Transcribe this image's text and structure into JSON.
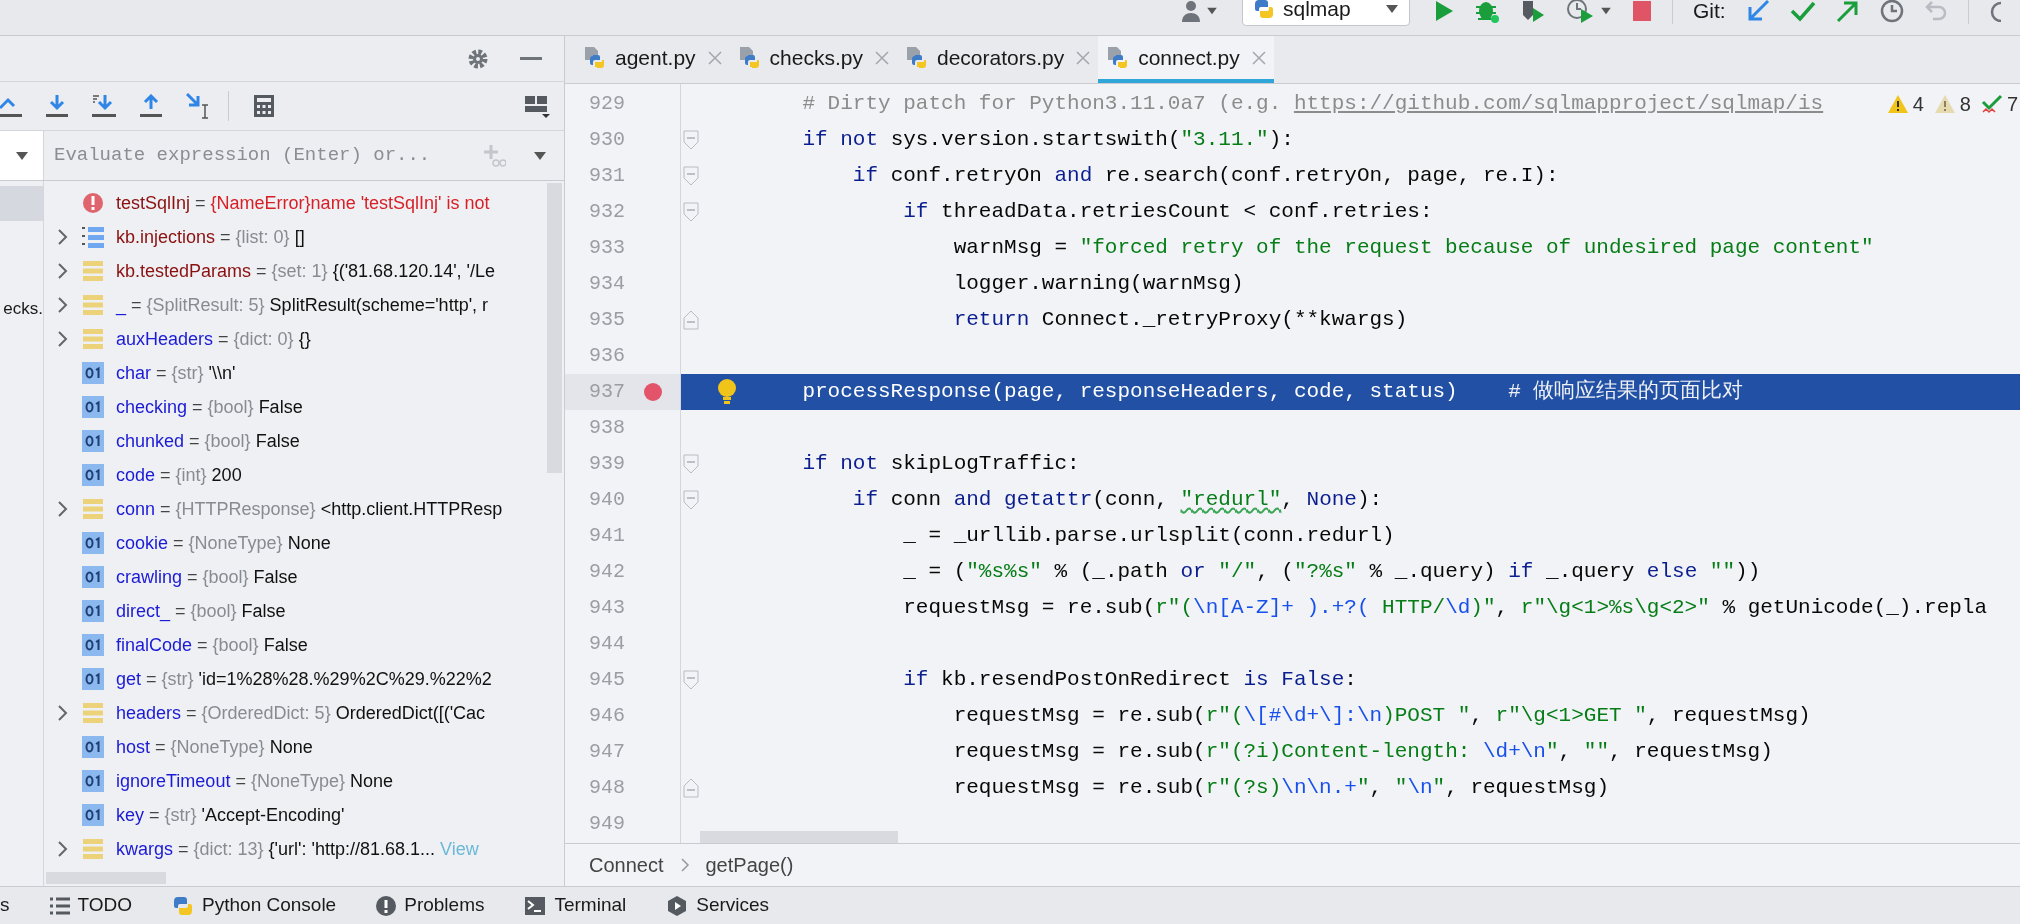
{
  "toolbar": {
    "run_config": "sqlmap",
    "vcs_label": "Git:"
  },
  "debugger": {
    "evaluate_placeholder": "Evaluate expression (Enter) or...",
    "frames": [
      {
        "selected": true
      },
      {
        "selected": false
      },
      {
        "selected": false
      },
      {
        "label": "ecks.",
        "selected": false
      }
    ],
    "assign": "=",
    "variables": [
      {
        "name": "testSqlInj",
        "kind": "watch_error",
        "expandable": false,
        "type": "{NameError}",
        "value": "name 'testSqlInj' is not"
      },
      {
        "name": "kb.injections",
        "kind": "watch_list",
        "expandable": true,
        "type": "{list: 0}",
        "value": "[]"
      },
      {
        "name": "kb.testedParams",
        "kind": "watch_collection",
        "expandable": true,
        "type": "{set: 1}",
        "value": "{('81.68.120.14', '/Le"
      },
      {
        "name": "_",
        "kind": "collection",
        "expandable": true,
        "type": "{SplitResult: 5}",
        "value": "SplitResult(scheme='http', r"
      },
      {
        "name": "auxHeaders",
        "kind": "collection",
        "expandable": true,
        "type": "{dict: 0}",
        "value": "{}"
      },
      {
        "name": "char",
        "kind": "scalar",
        "expandable": false,
        "type": "{str}",
        "value": "'\\\\n'"
      },
      {
        "name": "checking",
        "kind": "scalar",
        "expandable": false,
        "type": "{bool}",
        "value": "False"
      },
      {
        "name": "chunked",
        "kind": "scalar",
        "expandable": false,
        "type": "{bool}",
        "value": "False"
      },
      {
        "name": "code",
        "kind": "scalar",
        "expandable": false,
        "type": "{int}",
        "value": "200"
      },
      {
        "name": "conn",
        "kind": "collection",
        "expandable": true,
        "type": "{HTTPResponse}",
        "value": "<http.client.HTTPResp"
      },
      {
        "name": "cookie",
        "kind": "scalar",
        "expandable": false,
        "type": "{NoneType}",
        "value": "None"
      },
      {
        "name": "crawling",
        "kind": "scalar",
        "expandable": false,
        "type": "{bool}",
        "value": "False"
      },
      {
        "name": "direct_",
        "kind": "scalar",
        "expandable": false,
        "type": "{bool}",
        "value": "False"
      },
      {
        "name": "finalCode",
        "kind": "scalar",
        "expandable": false,
        "type": "{bool}",
        "value": "False"
      },
      {
        "name": "get",
        "kind": "scalar",
        "expandable": false,
        "type": "{str}",
        "value": "'id=1%28%28.%29%2C%29.%22%2"
      },
      {
        "name": "headers",
        "kind": "collection",
        "expandable": true,
        "type": "{OrderedDict: 5}",
        "value": "OrderedDict([('Cac"
      },
      {
        "name": "host",
        "kind": "scalar",
        "expandable": false,
        "type": "{NoneType}",
        "value": "None"
      },
      {
        "name": "ignoreTimeout",
        "kind": "scalar",
        "expandable": false,
        "type": "{NoneType}",
        "value": "None"
      },
      {
        "name": "key",
        "kind": "scalar",
        "expandable": false,
        "type": "{str}",
        "value": "'Accept-Encoding'"
      },
      {
        "name": "kwargs",
        "kind": "collection",
        "expandable": true,
        "type": "{dict: 13}",
        "value": "{'url': 'http://81.68.1...",
        "link": "View"
      }
    ]
  },
  "editor": {
    "tabs": [
      {
        "label": "agent.py",
        "selected": false
      },
      {
        "label": "checks.py",
        "selected": false
      },
      {
        "label": "decorators.py",
        "selected": false
      },
      {
        "label": "connect.py",
        "selected": true
      }
    ],
    "inspections": [
      {
        "kind": "warning",
        "count": "4"
      },
      {
        "kind": "weak_warning",
        "count": "8"
      },
      {
        "kind": "typo",
        "count": "7"
      }
    ],
    "lines": [
      {
        "number": "929",
        "selected": false,
        "breakpoint": false,
        "segments": [
          {
            "text": "    # Dirty patch for Python3.11.0a7 (e.g. ",
            "kind": "comment"
          },
          {
            "text": "https://github.com/sqlmapproject/sqlmap/is",
            "kind": "link"
          }
        ]
      },
      {
        "number": "930",
        "selected": false,
        "breakpoint": false,
        "kind": "fold_start",
        "segments": [
          {
            "text": "    if not",
            "kind": "kw"
          },
          {
            "text": " sys.version.startswith(",
            "kind": "plain"
          },
          {
            "text": "\"3.11.\"",
            "kind": "str"
          },
          {
            "text": "):",
            "kind": "plain"
          }
        ]
      },
      {
        "number": "931",
        "selected": false,
        "breakpoint": false,
        "kind": "fold_start",
        "segments": [
          {
            "text": "        if",
            "kind": "kw"
          },
          {
            "text": " conf.retryOn ",
            "kind": "plain"
          },
          {
            "text": "and",
            "kind": "kw"
          },
          {
            "text": " re.search(conf.retryOn, page, re.I):",
            "kind": "plain"
          }
        ]
      },
      {
        "number": "932",
        "selected": false,
        "breakpoint": false,
        "kind": "fold_start",
        "segments": [
          {
            "text": "            if",
            "kind": "kw"
          },
          {
            "text": " threadData.retriesCount < conf.retries:",
            "kind": "plain"
          }
        ]
      },
      {
        "number": "933",
        "selected": false,
        "breakpoint": false,
        "segments": [
          {
            "text": "                warnMsg = ",
            "kind": "plain"
          },
          {
            "text": "\"forced retry of the request because of undesired page content\"",
            "kind": "str"
          }
        ]
      },
      {
        "number": "934",
        "selected": false,
        "breakpoint": false,
        "segments": [
          {
            "text": "                logger.warning(warnMsg)",
            "kind": "plain"
          }
        ]
      },
      {
        "number": "935",
        "selected": false,
        "breakpoint": false,
        "kind": "fold_end",
        "segments": [
          {
            "text": "                return",
            "kind": "kw"
          },
          {
            "text": " Connect._retryProxy(**kwargs)",
            "kind": "plain"
          }
        ]
      },
      {
        "number": "936",
        "selected": false,
        "breakpoint": false
      },
      {
        "number": "937",
        "selected": true,
        "breakpoint": true,
        "segments": [
          {
            "text": "    processResponse(page, responseHeaders, code, status)    ",
            "kind": "plain"
          },
          {
            "text": "# 做响应结果的页面比对",
            "kind": "comment"
          }
        ]
      },
      {
        "number": "938",
        "selected": false,
        "breakpoint": false
      },
      {
        "number": "939",
        "selected": false,
        "breakpoint": false,
        "kind": "fold_start",
        "segments": [
          {
            "text": "    if not",
            "kind": "kw"
          },
          {
            "text": " skipLogTraffic:",
            "kind": "plain"
          }
        ]
      },
      {
        "number": "940",
        "selected": false,
        "breakpoint": false,
        "kind": "fold_start",
        "segments": [
          {
            "text": "        if",
            "kind": "kw"
          },
          {
            "text": " conn ",
            "kind": "plain"
          },
          {
            "text": "and getattr",
            "kind": "kw"
          },
          {
            "text": "(conn, ",
            "kind": "plain"
          },
          {
            "text": "\"redurl\"",
            "kind": "str_typo"
          },
          {
            "text": ", ",
            "kind": "plain"
          },
          {
            "text": "None",
            "kind": "kw"
          },
          {
            "text": "):",
            "kind": "plain"
          }
        ]
      },
      {
        "number": "941",
        "selected": false,
        "breakpoint": false,
        "segments": [
          {
            "text": "            _ = _urllib.parse.urlsplit(conn.redurl)",
            "kind": "plain"
          }
        ]
      },
      {
        "number": "942",
        "selected": false,
        "breakpoint": false,
        "segments": [
          {
            "text": "            _ = (",
            "kind": "plain"
          },
          {
            "text": "\"%s%s\"",
            "kind": "str"
          },
          {
            "text": " % (_.path ",
            "kind": "plain"
          },
          {
            "text": "or",
            "kind": "kw"
          },
          {
            "text": " \"/\"",
            "kind": "str"
          },
          {
            "text": ", (",
            "kind": "plain"
          },
          {
            "text": "\"?%s\"",
            "kind": "str"
          },
          {
            "text": " % _.query) ",
            "kind": "plain"
          },
          {
            "text": "if",
            "kind": "kw"
          },
          {
            "text": " _.query ",
            "kind": "plain"
          },
          {
            "text": "else",
            "kind": "kw"
          },
          {
            "text": " \"\"",
            "kind": "str"
          },
          {
            "text": "))",
            "kind": "plain"
          }
        ]
      },
      {
        "number": "943",
        "selected": false,
        "breakpoint": false,
        "segments": [
          {
            "text": "            requestMsg = re.sub(",
            "kind": "plain"
          },
          {
            "text": "r\"(",
            "kind": "str"
          },
          {
            "text": "\\n[A-Z]+ ).+?(",
            "kind": "esc"
          },
          {
            "text": " HTTP/",
            "kind": "str"
          },
          {
            "text": "\\d",
            "kind": "esc"
          },
          {
            "text": ")\"",
            "kind": "str"
          },
          {
            "text": ", ",
            "kind": "plain"
          },
          {
            "text": "r\"\\g<1>%s\\g<2>\"",
            "kind": "str"
          },
          {
            "text": " % getUnicode(_).repla",
            "kind": "plain"
          }
        ]
      },
      {
        "number": "944",
        "selected": false,
        "breakpoint": false
      },
      {
        "number": "945",
        "selected": false,
        "breakpoint": false,
        "kind": "fold_start",
        "segments": [
          {
            "text": "            if",
            "kind": "kw"
          },
          {
            "text": " kb.resendPostOnRedirect ",
            "kind": "plain"
          },
          {
            "text": "is False",
            "kind": "kw"
          },
          {
            "text": ":",
            "kind": "plain"
          }
        ]
      },
      {
        "number": "946",
        "selected": false,
        "breakpoint": false,
        "segments": [
          {
            "text": "                requestMsg = re.sub(",
            "kind": "plain"
          },
          {
            "text": "r\"(",
            "kind": "str"
          },
          {
            "text": "\\[#\\d+\\]:\\n",
            "kind": "esc"
          },
          {
            "text": ")POST \"",
            "kind": "str"
          },
          {
            "text": ", ",
            "kind": "plain"
          },
          {
            "text": "r\"\\g<1>GET \"",
            "kind": "str"
          },
          {
            "text": ", requestMsg)",
            "kind": "plain"
          }
        ]
      },
      {
        "number": "947",
        "selected": false,
        "breakpoint": false,
        "segments": [
          {
            "text": "                requestMsg = re.sub(",
            "kind": "plain"
          },
          {
            "text": "r\"(?i)Content-length: ",
            "kind": "str"
          },
          {
            "text": "\\d+\\n",
            "kind": "esc"
          },
          {
            "text": "\"",
            "kind": "str"
          },
          {
            "text": ", ",
            "kind": "plain"
          },
          {
            "text": "\"\"",
            "kind": "str"
          },
          {
            "text": ", requestMsg)",
            "kind": "plain"
          }
        ]
      },
      {
        "number": "948",
        "selected": false,
        "breakpoint": false,
        "kind": "fold_end",
        "segments": [
          {
            "text": "                requestMsg = re.sub(",
            "kind": "plain"
          },
          {
            "text": "r\"(?s)",
            "kind": "str"
          },
          {
            "text": "\\n\\n.+",
            "kind": "esc"
          },
          {
            "text": "\"",
            "kind": "str"
          },
          {
            "text": ", ",
            "kind": "plain"
          },
          {
            "text": "\"",
            "kind": "str"
          },
          {
            "text": "\\n",
            "kind": "esc"
          },
          {
            "text": "\"",
            "kind": "str"
          },
          {
            "text": ", requestMsg)",
            "kind": "plain"
          }
        ]
      },
      {
        "number": "949",
        "selected": false,
        "breakpoint": false
      }
    ],
    "breadcrumbs": [
      "Connect",
      "getPage()"
    ]
  },
  "tool_windows": [
    {
      "label": "s",
      "kind": "plain"
    },
    {
      "label": "TODO",
      "kind": "todo"
    },
    {
      "label": "Python Console",
      "kind": "console"
    },
    {
      "label": "Problems",
      "kind": "problems"
    },
    {
      "label": "Terminal",
      "kind": "terminal"
    },
    {
      "label": "Services",
      "kind": "services"
    }
  ]
}
